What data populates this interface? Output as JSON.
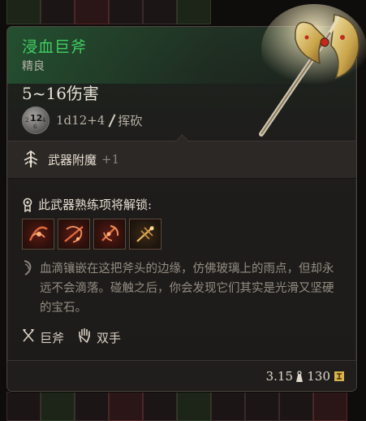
{
  "item": {
    "name": "浸血巨斧",
    "rarity": "精良",
    "damage": "5~16伤害",
    "dice_face": "12",
    "damage_formula": "1d12+4",
    "damage_type": "挥砍"
  },
  "enchantment": {
    "label": "武器附魔",
    "bonus": "+1"
  },
  "proficiency": {
    "label": "此武器熟练项将解锁:",
    "actions": [
      {
        "icon": "cleave-action-icon"
      },
      {
        "icon": "lacerate-action-icon"
      },
      {
        "icon": "weakening-strike-icon"
      },
      {
        "icon": "topple-action-icon"
      }
    ]
  },
  "description": "血滴镶嵌在这把斧头的边缘，仿佛玻璃上的雨点，但却永远不会滴落。碰触之后，你会发现它们其实是光滑又坚硬的宝石。",
  "tags": {
    "weapon_type": "巨斧",
    "handedness": "双手"
  },
  "footer": {
    "weight": "3.15",
    "value": "130"
  },
  "colors": {
    "title": "#3fcf62",
    "accent_gold": "#d9b24a"
  }
}
